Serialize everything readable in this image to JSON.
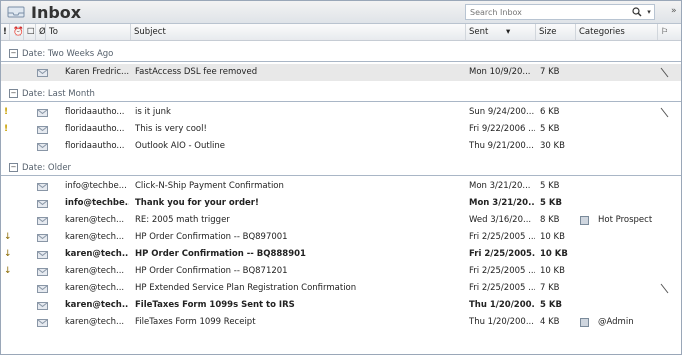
{
  "window": {
    "title": "Inbox"
  },
  "search": {
    "placeholder": "Search Inbox"
  },
  "columns": [
    {
      "key": "importance",
      "label": "!"
    },
    {
      "key": "reminder",
      "label": "⏰"
    },
    {
      "key": "icon",
      "label": "☐"
    },
    {
      "key": "attachment",
      "label": "Ø"
    },
    {
      "key": "to",
      "label": "To"
    },
    {
      "key": "subject",
      "label": "Subject"
    },
    {
      "key": "sent",
      "label": "Sent"
    },
    {
      "key": "size",
      "label": "Size"
    },
    {
      "key": "categories",
      "label": "Categories"
    },
    {
      "key": "flag",
      "label": "⚐"
    }
  ],
  "groups": [
    {
      "label": "Date: Two Weeks Ago",
      "rows": [
        {
          "to": "Karen Fredric...",
          "subject": "FastAccess DSL fee removed",
          "sent": "Mon 10/9/20...",
          "size": "7 KB",
          "categories": "",
          "selected": true,
          "unread": false,
          "importance": "",
          "flag": true
        }
      ]
    },
    {
      "label": "Date: Last Month",
      "rows": [
        {
          "to": "floridaautho...",
          "subject": "is it junk",
          "sent": "Sun 9/24/200...",
          "size": "6 KB",
          "categories": "",
          "selected": false,
          "unread": false,
          "importance": "!",
          "flag": true
        },
        {
          "to": "floridaautho...",
          "subject": "This is very cool!",
          "sent": "Fri 9/22/2006 ...",
          "size": "5 KB",
          "categories": "",
          "selected": false,
          "unread": false,
          "importance": "!",
          "flag": false
        },
        {
          "to": "floridaautho...",
          "subject": "Outlook AIO - Outline",
          "sent": "Thu 9/21/200...",
          "size": "30 KB",
          "categories": "",
          "selected": false,
          "unread": false,
          "importance": "",
          "flag": false
        }
      ]
    },
    {
      "label": "Date: Older",
      "rows": [
        {
          "to": "info@techbe...",
          "subject": "Click-N-Ship Payment Confirmation",
          "sent": "Mon 3/21/20...",
          "size": "5 KB",
          "categories": "",
          "selected": false,
          "unread": false,
          "importance": "",
          "flag": false
        },
        {
          "to": "info@techbe...",
          "subject": "Thank you for your order!",
          "sent": "Mon 3/21/20...",
          "size": "5 KB",
          "categories": "",
          "selected": false,
          "unread": true,
          "importance": "",
          "flag": false
        },
        {
          "to": "karen@tech...",
          "subject": "RE: 2005 math trigger",
          "sent": "Wed 3/16/20...",
          "size": "8 KB",
          "categories": "Hot Prospect",
          "selected": false,
          "unread": false,
          "importance": "",
          "flag": false
        },
        {
          "to": "karen@tech...",
          "subject": "HP Order Confirmation -- BQ897001",
          "sent": "Fri 2/25/2005 ...",
          "size": "10 KB",
          "categories": "",
          "selected": false,
          "unread": false,
          "importance": "↓",
          "flag": false
        },
        {
          "to": "karen@tech...",
          "subject": "HP Order Confirmation -- BQ888901",
          "sent": "Fri 2/25/2005...",
          "size": "10 KB",
          "categories": "",
          "selected": false,
          "unread": true,
          "importance": "↓",
          "flag": false
        },
        {
          "to": "karen@tech...",
          "subject": "HP Order Confirmation -- BQ871201",
          "sent": "Fri 2/25/2005 ...",
          "size": "10 KB",
          "categories": "",
          "selected": false,
          "unread": false,
          "importance": "↓",
          "flag": false
        },
        {
          "to": "karen@tech...",
          "subject": "HP Extended Service Plan Registration Confirmation",
          "sent": "Fri 2/25/2005 ...",
          "size": "7 KB",
          "categories": "",
          "selected": false,
          "unread": false,
          "importance": "",
          "flag": true
        },
        {
          "to": "karen@tech...",
          "subject": "FileTaxes Form 1099s Sent to IRS",
          "sent": "Thu 1/20/200...",
          "size": "5 KB",
          "categories": "",
          "selected": false,
          "unread": true,
          "importance": "",
          "flag": false
        },
        {
          "to": "karen@tech...",
          "subject": "FileTaxes Form 1099 Receipt",
          "sent": "Thu 1/20/200...",
          "size": "4 KB",
          "categories": "@Admin",
          "selected": false,
          "unread": false,
          "importance": "",
          "flag": false
        }
      ]
    }
  ],
  "colors": {
    "accent": "#4a78b5",
    "selected_row": "#e8e8e8",
    "group_line": "#a9b6c6"
  }
}
